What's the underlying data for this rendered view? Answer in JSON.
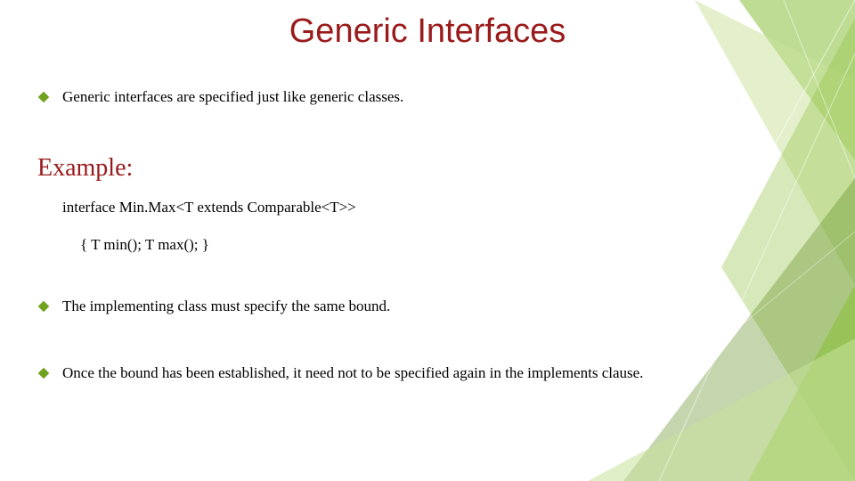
{
  "title": "Generic Interfaces",
  "bullets": {
    "b1": "Generic interfaces are specified just like generic classes.",
    "b2": "The implementing class must  specify the same bound.",
    "b3": "Once the bound has been established, it need not to be specified again in the implements clause."
  },
  "example": {
    "heading": "Example:",
    "line1": "interface Min.Max<T extends Comparable<T>>",
    "line2": "{   T min();  T max(); }"
  },
  "colors": {
    "title": "#9a1b1b",
    "bullet": "#6fa21f",
    "deco_dark": "#5a8a1a",
    "deco_mid": "#8bbf3d",
    "deco_light": "#c9e29a"
  }
}
